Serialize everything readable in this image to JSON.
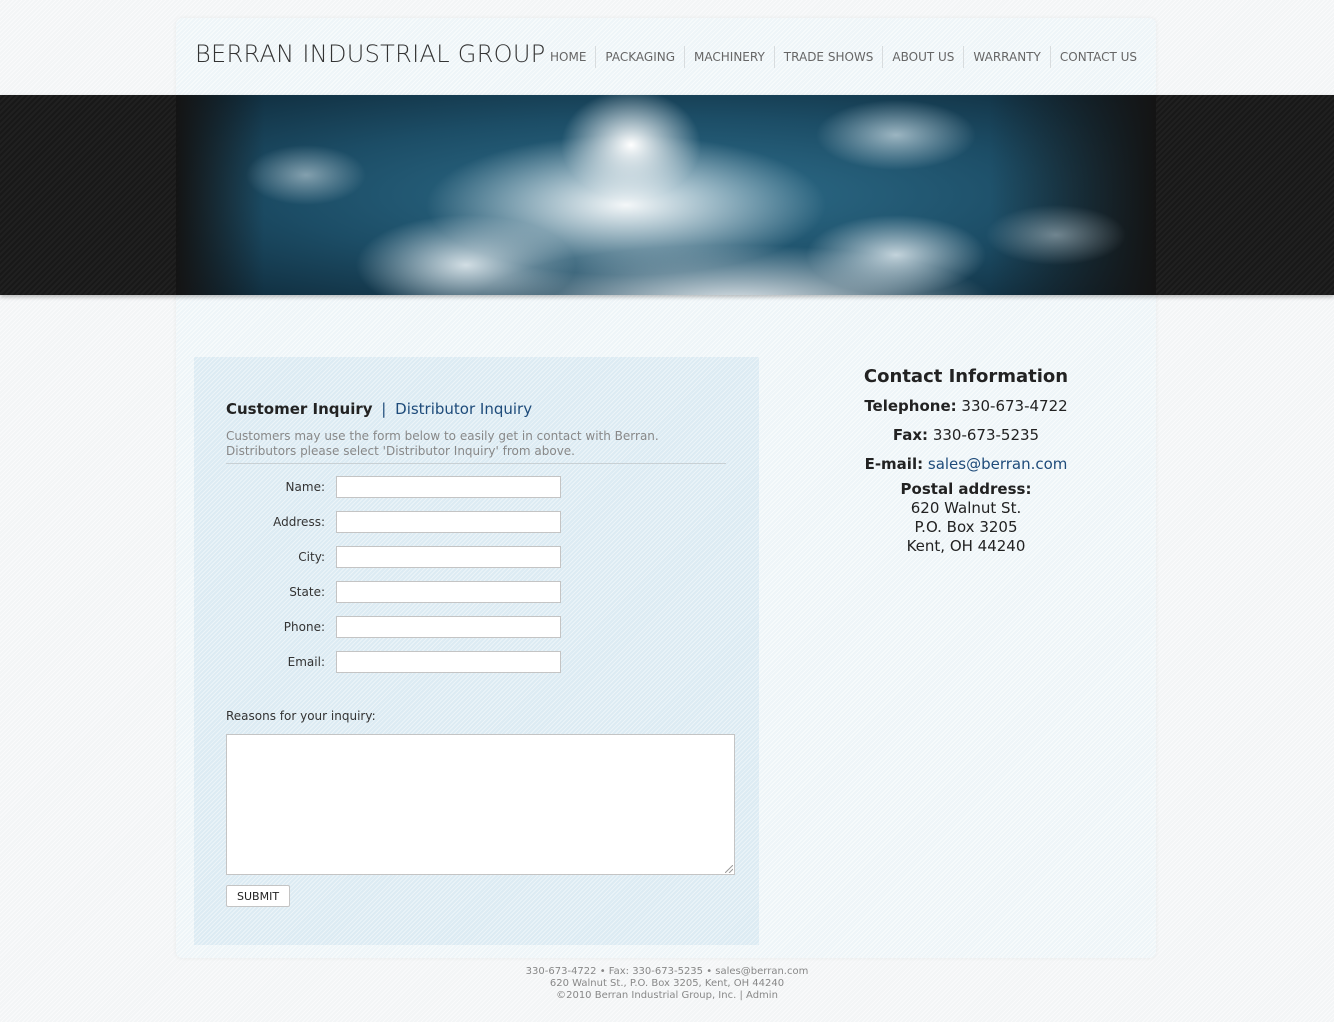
{
  "header": {
    "brand": "BERRAN INDUSTRIAL GROUP",
    "nav": [
      {
        "label": "HOME"
      },
      {
        "label": "PACKAGING"
      },
      {
        "label": "MACHINERY"
      },
      {
        "label": "TRADE SHOWS"
      },
      {
        "label": "ABOUT US"
      },
      {
        "label": "WARRANTY"
      },
      {
        "label": "CONTACT US"
      }
    ]
  },
  "form": {
    "tab_active": "Customer Inquiry",
    "tab_separator": "|",
    "tab_other": "Distributor Inquiry",
    "intro": "Customers may use the form below to easily get in contact with Berran. Distributors please select 'Distributor Inquiry' from above.",
    "fields": [
      {
        "label": "Name:",
        "value": ""
      },
      {
        "label": "Address:",
        "value": ""
      },
      {
        "label": "City:",
        "value": ""
      },
      {
        "label": "State:",
        "value": ""
      },
      {
        "label": "Phone:",
        "value": ""
      },
      {
        "label": "Email:",
        "value": ""
      }
    ],
    "reasons_label": "Reasons for your inquiry:",
    "reasons_value": "",
    "submit_label": "SUBMIT"
  },
  "contact": {
    "title": "Contact Information",
    "telephone_label": "Telephone:",
    "telephone": "330-673-4722",
    "fax_label": "Fax:",
    "fax": "330-673-5235",
    "email_label": "E-mail:",
    "email": "sales@berran.com",
    "postal_label": "Postal address:",
    "postal_lines": [
      "620 Walnut St.",
      "P.O. Box 3205",
      "Kent, OH 44240"
    ]
  },
  "footer": {
    "line1": "330-673-4722 • Fax: 330-673-5235 • sales@berran.com",
    "line2": "620 Walnut St., P.O. Box 3205, Kent, OH 44240",
    "copyright": "©2010 Berran Industrial Group, Inc.",
    "separator": "|",
    "admin_link": "Admin"
  },
  "colors": {
    "link": "#1e4b7a",
    "panel_bg": "#dcebf3",
    "banner_bg": "#1a1a1a"
  }
}
